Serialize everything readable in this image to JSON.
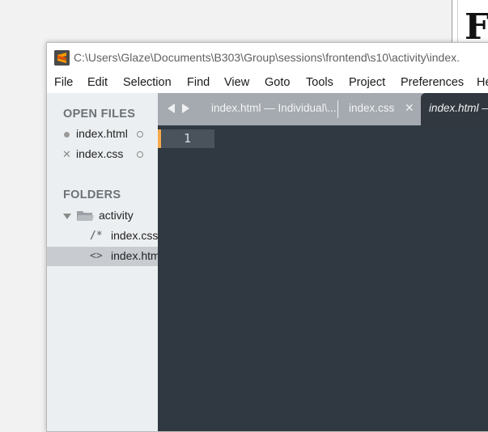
{
  "background_window": {
    "visible_glyph": "F"
  },
  "window": {
    "title": "C:\\Users\\Glaze\\Documents\\B303\\Group\\sessions\\frontend\\s10\\activity\\index.",
    "app_icon": "sublime-text-icon"
  },
  "menu": [
    "File",
    "Edit",
    "Selection",
    "Find",
    "View",
    "Goto",
    "Tools",
    "Project",
    "Preferences",
    "He"
  ],
  "sidebar": {
    "open_files_heading": "OPEN FILES",
    "open_files": [
      {
        "name": "index.html",
        "state": "unsaved"
      },
      {
        "name": "index.css",
        "state": "close"
      }
    ],
    "folders_heading": "FOLDERS",
    "folder": {
      "name": "activity",
      "expanded": true
    },
    "folder_files": [
      {
        "name": "index.css",
        "glyph": "/*",
        "selected": false
      },
      {
        "name": "index.html",
        "glyph": "<>",
        "selected": true
      }
    ]
  },
  "tabs": [
    {
      "label": "index.html — Individual\\...",
      "active": false
    },
    {
      "label": "index.css",
      "active": false,
      "close_glyph": "✕"
    },
    {
      "label": "index.html — ",
      "active": true
    }
  ],
  "editor": {
    "line_numbers": [
      "1"
    ],
    "colors": {
      "background": "#303841",
      "gutter_highlight": "#4a535c",
      "cursor_accent": "#f5a94a"
    }
  }
}
